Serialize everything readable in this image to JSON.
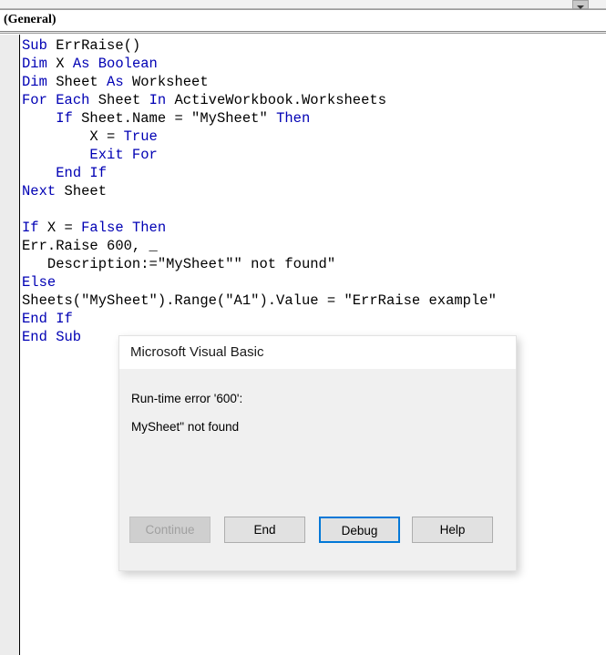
{
  "window": {
    "procedure_selector_label": "(General)",
    "dropdown_icon": "chevron-down-icon"
  },
  "editor": {
    "language": "VBA",
    "code_lines": [
      [
        {
          "t": "Sub",
          "k": true
        },
        {
          "t": " ErrRaise()",
          "k": false
        }
      ],
      [
        {
          "t": "Dim",
          "k": true
        },
        {
          "t": " X ",
          "k": false
        },
        {
          "t": "As",
          "k": true
        },
        {
          "t": " ",
          "k": false
        },
        {
          "t": "Boolean",
          "k": true
        }
      ],
      [
        {
          "t": "Dim",
          "k": true
        },
        {
          "t": " Sheet ",
          "k": false
        },
        {
          "t": "As",
          "k": true
        },
        {
          "t": " Worksheet",
          "k": false
        }
      ],
      [
        {
          "t": "For",
          "k": true
        },
        {
          "t": " ",
          "k": false
        },
        {
          "t": "Each",
          "k": true
        },
        {
          "t": " Sheet ",
          "k": false
        },
        {
          "t": "In",
          "k": true
        },
        {
          "t": " ActiveWorkbook.Worksheets",
          "k": false
        }
      ],
      [
        {
          "t": "    ",
          "k": false
        },
        {
          "t": "If",
          "k": true
        },
        {
          "t": " Sheet.Name = \"MySheet\" ",
          "k": false
        },
        {
          "t": "Then",
          "k": true
        }
      ],
      [
        {
          "t": "        X = ",
          "k": false
        },
        {
          "t": "True",
          "k": true
        }
      ],
      [
        {
          "t": "        ",
          "k": false
        },
        {
          "t": "Exit For",
          "k": true
        }
      ],
      [
        {
          "t": "    ",
          "k": false
        },
        {
          "t": "End If",
          "k": true
        }
      ],
      [
        {
          "t": "Next",
          "k": true
        },
        {
          "t": " Sheet",
          "k": false
        }
      ],
      [],
      [
        {
          "t": "If",
          "k": true
        },
        {
          "t": " X = ",
          "k": false
        },
        {
          "t": "False",
          "k": true
        },
        {
          "t": " ",
          "k": false
        },
        {
          "t": "Then",
          "k": true
        }
      ],
      [
        {
          "t": "Err.Raise 600, _",
          "k": false
        }
      ],
      [
        {
          "t": "   Description:=\"MySheet\"\" not found\"",
          "k": false
        }
      ],
      [
        {
          "t": "Else",
          "k": true
        }
      ],
      [
        {
          "t": "Sheets(\"MySheet\").Range(\"A1\").Value = \"ErrRaise example\"",
          "k": false
        }
      ],
      [
        {
          "t": "End If",
          "k": true
        }
      ],
      [
        {
          "t": "End Sub",
          "k": true
        }
      ]
    ]
  },
  "dialog": {
    "title": "Microsoft Visual Basic",
    "message_line_1": "Run-time error '600':",
    "message_line_2": "MySheet\" not found",
    "buttons": [
      {
        "label": "Continue",
        "name": "continue-button",
        "disabled": true,
        "focused": false
      },
      {
        "label": "End",
        "name": "end-button",
        "disabled": false,
        "focused": false
      },
      {
        "label": "Debug",
        "name": "debug-button",
        "disabled": false,
        "focused": true
      },
      {
        "label": "Help",
        "name": "help-button",
        "disabled": false,
        "focused": false
      }
    ],
    "focus_color": "#0078d7"
  }
}
